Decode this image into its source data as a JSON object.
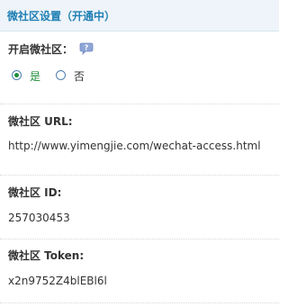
{
  "header": {
    "title": "微社区设置（开通中）"
  },
  "enable": {
    "label": "开启微社区：",
    "help_icon": "question-bubble-icon",
    "options": [
      {
        "label": "是",
        "selected": true
      },
      {
        "label": "否",
        "selected": false
      }
    ]
  },
  "url": {
    "label": "微社区 URL:",
    "value": "http://www.yimengjie.com/wechat-access.html"
  },
  "id": {
    "label": "微社区 ID:",
    "value": "257030453"
  },
  "token": {
    "label": "微社区 Token:",
    "value": "x2n9752Z4blEBl6l"
  },
  "colors": {
    "header_text": "#1f7fb4",
    "header_bg": "#eef4f9",
    "selected_option": "#1e8c3a",
    "radio_border": "#4f7fb0"
  }
}
